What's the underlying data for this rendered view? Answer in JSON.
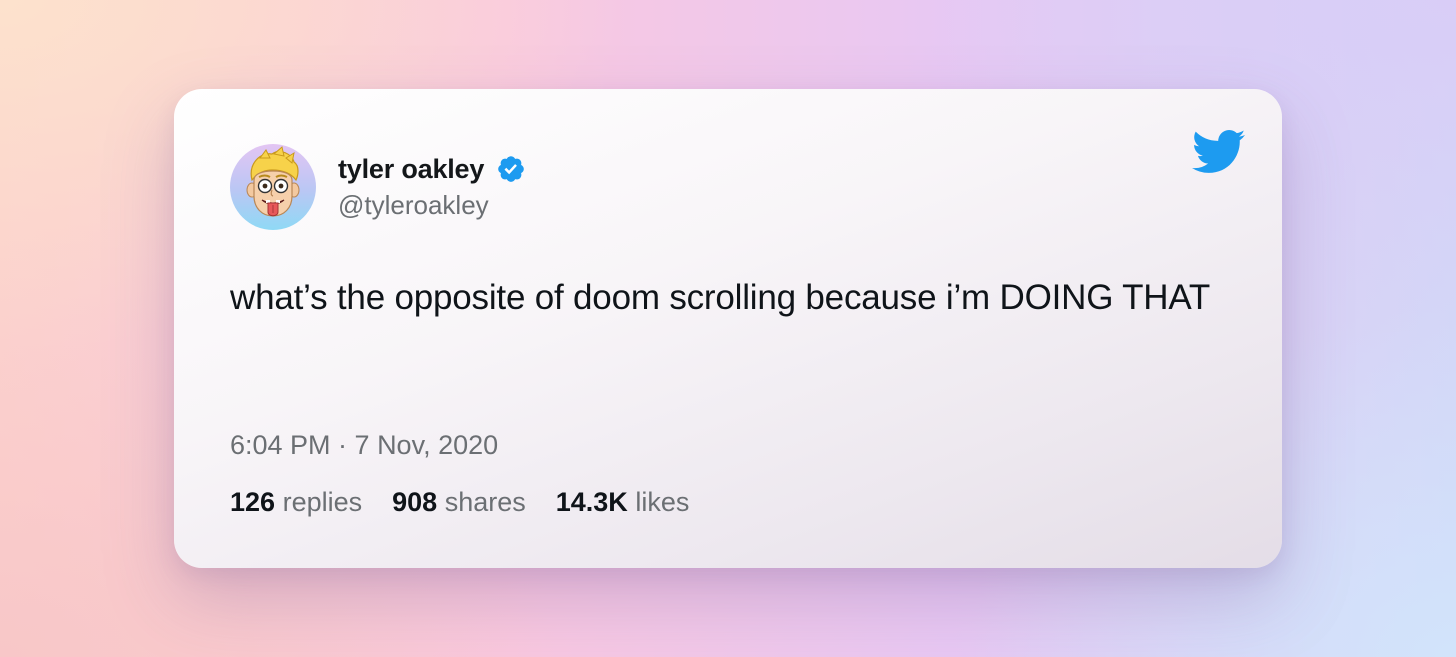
{
  "tweet": {
    "author": {
      "name": "tyler oakley",
      "handle": "@tyleroakley",
      "verified": true,
      "avatar_icon": "cartoon-avatar-icon"
    },
    "text": "what’s the opposite of doom scrolling because i’m DOING THAT",
    "timestamp": "6:04 PM · 7 Nov, 2020",
    "stats": {
      "replies": {
        "count": "126",
        "label": "replies"
      },
      "shares": {
        "count": "908",
        "label": "shares"
      },
      "likes": {
        "count": "14.3K",
        "label": "likes"
      }
    }
  },
  "colors": {
    "twitter_blue": "#1d9bf0",
    "verified_blue": "#1d9bf0",
    "text_primary": "#0f1419",
    "text_secondary": "#6b6f73"
  },
  "icons": {
    "brand": "twitter-bird-icon",
    "verified": "verified-badge-icon"
  }
}
